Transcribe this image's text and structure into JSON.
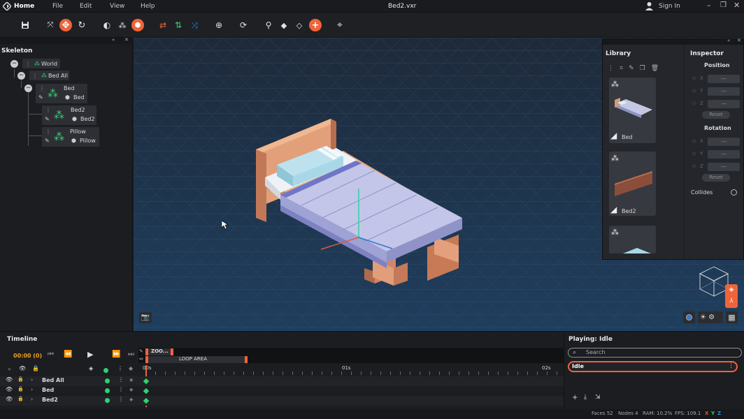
{
  "menubar": {
    "home": "Home",
    "menus": [
      "File",
      "Edit",
      "View",
      "Help"
    ],
    "title": "Bed2.vxr",
    "signin": "Sign In"
  },
  "skeleton": {
    "title": "Skeleton",
    "nodes": [
      {
        "name": "World"
      },
      {
        "name": "Bed All"
      },
      {
        "name": "Bed",
        "mesh": "Bed"
      },
      {
        "name": "Bed2",
        "mesh": "Bed2"
      },
      {
        "name": "Pillow",
        "mesh": "Pillow"
      }
    ]
  },
  "library": {
    "title": "Library",
    "items": [
      "Bed",
      "Bed2",
      ""
    ]
  },
  "inspector": {
    "title": "Inspector",
    "position_label": "Position",
    "rotation_label": "Rotation",
    "axes": [
      "X",
      "Y",
      "Z"
    ],
    "field_value": "---",
    "reset_label": "Reset",
    "collides_label": "Collides"
  },
  "timeline": {
    "title": "Timeline",
    "time": "00:00 (0)",
    "zoom_label": "ZOO...",
    "loop_label": "LOOP AREA",
    "ticks": [
      "00s",
      "01s",
      "02s"
    ],
    "tracks": [
      "Bed All",
      "Bed",
      "Bed2"
    ]
  },
  "animations": {
    "title": "Playing: Idle",
    "search_placeholder": "Search",
    "items": [
      "Idle"
    ]
  },
  "status": {
    "faces": "Faces 52",
    "nodes": "Nodes 4",
    "ram": "RAM: 10.2%",
    "fps": "FPS: 109.1",
    "x": "X",
    "y": "Y",
    "z": "Z"
  },
  "colors": {
    "accent": "#f0643a",
    "green": "#2fd36e",
    "blue": "#2b8ce6"
  }
}
